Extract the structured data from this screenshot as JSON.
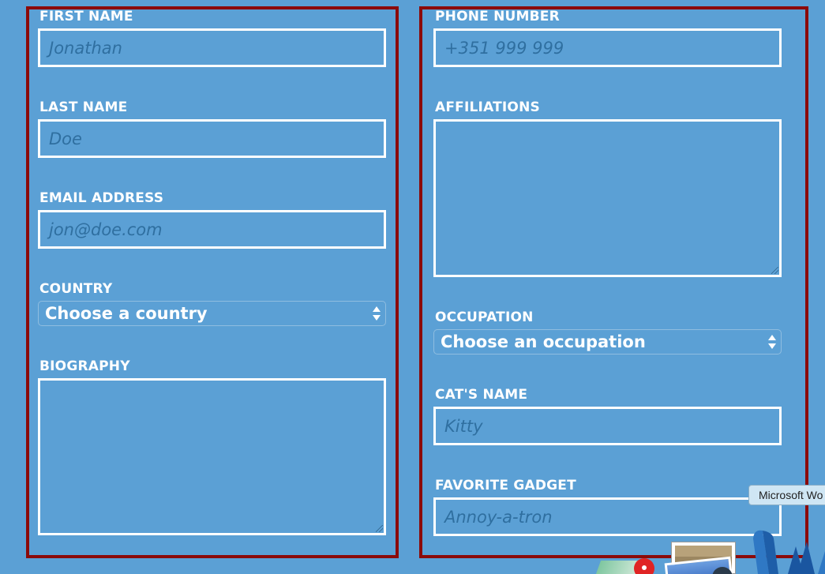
{
  "form": {
    "left": {
      "first_name": {
        "label": "FIRST NAME",
        "placeholder": "Jonathan"
      },
      "last_name": {
        "label": "LAST NAME",
        "placeholder": "Doe"
      },
      "email": {
        "label": "EMAIL ADDRESS",
        "placeholder": "jon@doe.com"
      },
      "country": {
        "label": "COUNTRY",
        "selected": "Choose a country"
      },
      "biography": {
        "label": "BIOGRAPHY"
      }
    },
    "right": {
      "phone": {
        "label": "PHONE NUMBER",
        "placeholder": "+351 999 999"
      },
      "affiliations": {
        "label": "AFFILIATIONS"
      },
      "occupation": {
        "label": "OCCUPATION",
        "selected": "Choose an occupation"
      },
      "cats_name": {
        "label": "CAT'S NAME",
        "placeholder": "Kitty"
      },
      "favorite_gadget": {
        "label": "FAVORITE GADGET",
        "placeholder": "Annoy-a-tron"
      }
    }
  },
  "dock": {
    "tooltip": "Microsoft Wo",
    "icons": [
      "maps-icon",
      "photo-icon",
      "word-icon"
    ]
  },
  "colors": {
    "background": "#5ba0d5",
    "column_border": "#8b0a0a",
    "field_border": "#ffffff",
    "placeholder": "#2f6fa0"
  }
}
